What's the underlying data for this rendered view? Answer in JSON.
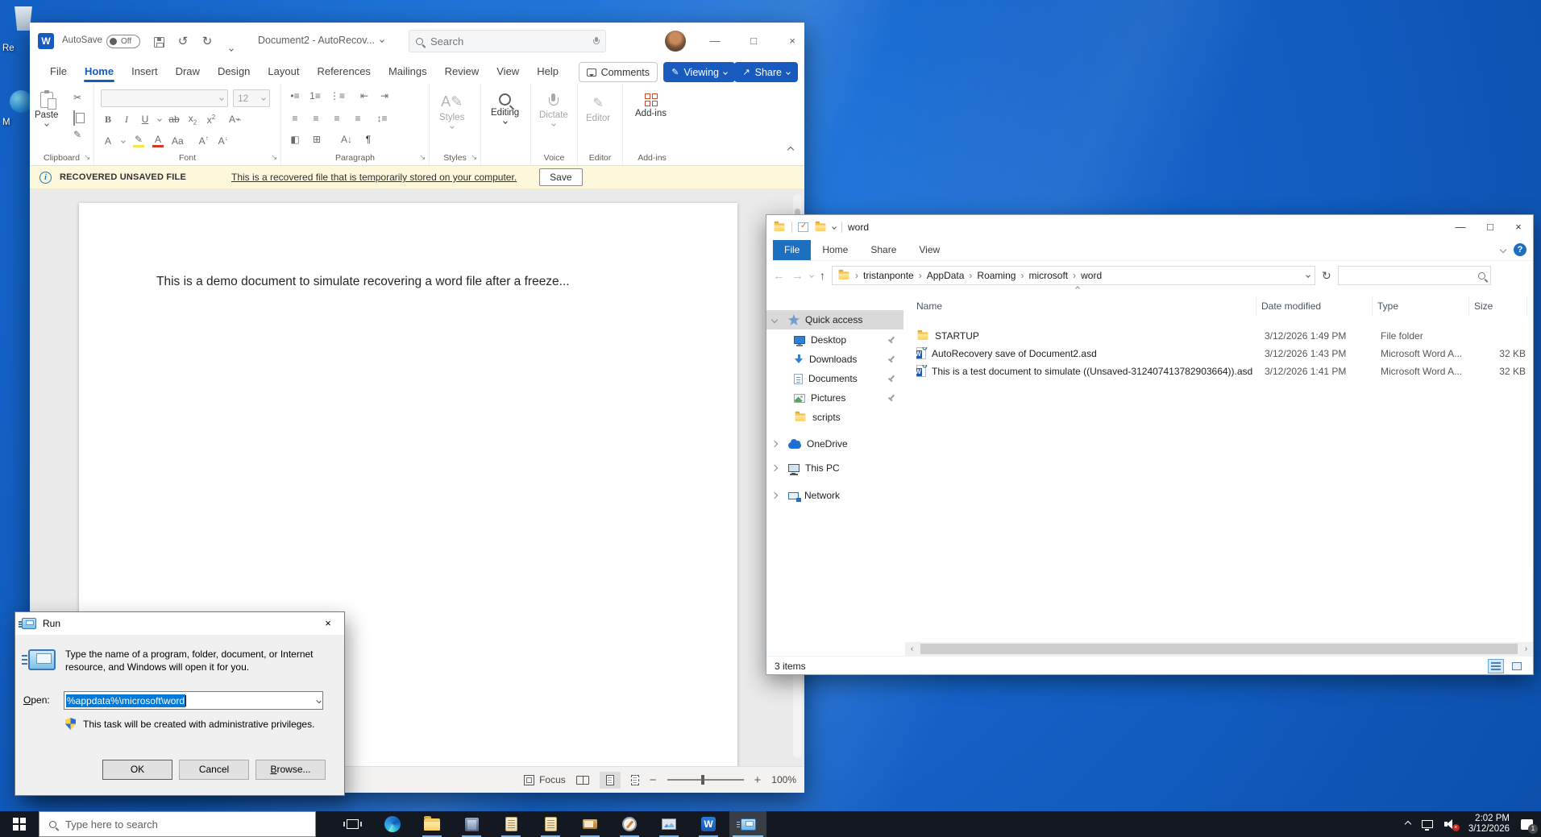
{
  "desktop": {
    "recycle_bin_label": "Re",
    "second_icon_label": "M"
  },
  "word": {
    "titlebar": {
      "autosave_label": "AutoSave",
      "autosave_state": "Off",
      "doc_title": "Document2 - AutoRecov...",
      "search_placeholder": "Search"
    },
    "tabs": [
      "File",
      "Home",
      "Insert",
      "Draw",
      "Design",
      "Layout",
      "References",
      "Mailings",
      "Review",
      "View",
      "Help"
    ],
    "buttons": {
      "comments": "Comments",
      "viewing": "Viewing",
      "share": "Share"
    },
    "ribbon": {
      "paste": "Paste",
      "font_size": "12",
      "styles": "Styles",
      "editing": "Editing",
      "dictate": "Dictate",
      "editor": "Editor",
      "addins": "Add-ins",
      "groups": {
        "clipboard": "Clipboard",
        "font": "Font",
        "paragraph": "Paragraph",
        "styles": "Styles",
        "voice": "Voice",
        "editor": "Editor",
        "addins": "Add-ins"
      }
    },
    "infobar": {
      "badge": "RECOVERED UNSAVED FILE",
      "message": "This is a recovered file that is temporarily stored on your computer.",
      "save": "Save"
    },
    "document_text": "This is a demo document to simulate recovering a word file after a freeze...",
    "statusbar": {
      "focus": "Focus",
      "zoom": "100%"
    }
  },
  "explorer": {
    "title": "word",
    "tabs": [
      "File",
      "Home",
      "Share",
      "View"
    ],
    "breadcrumb": [
      "tristanponte",
      "AppData",
      "Roaming",
      "microsoft",
      "word"
    ],
    "columns": [
      "Name",
      "Date modified",
      "Type",
      "Size"
    ],
    "files": [
      {
        "name": "STARTUP",
        "date": "3/12/2026 1:49 PM",
        "type": "File folder",
        "size": ""
      },
      {
        "name": "AutoRecovery save of Document2.asd",
        "date": "3/12/2026 1:43 PM",
        "type": "Microsoft Word A...",
        "size": "32 KB"
      },
      {
        "name": "This is a test document to simulate ((Unsaved-312407413782903664)).asd",
        "date": "3/12/2026 1:41 PM",
        "type": "Microsoft Word A...",
        "size": "32 KB"
      }
    ],
    "sidebar": {
      "quick_access": "Quick access",
      "desktop": "Desktop",
      "downloads": "Downloads",
      "documents": "Documents",
      "pictures": "Pictures",
      "scripts": "scripts",
      "onedrive": "OneDrive",
      "this_pc": "This PC",
      "network": "Network"
    },
    "status": "3 items"
  },
  "run": {
    "title": "Run",
    "description": "Type the name of a program, folder, document, or Internet resource, and Windows will open it for you.",
    "open_label": "Open:",
    "open_value": "%appdata%\\microsoft\\word",
    "admin_note": "This task will be created with administrative privileges.",
    "ok": "OK",
    "cancel": "Cancel",
    "browse": "Browse..."
  },
  "taskbar": {
    "search_placeholder": "Type here to search",
    "time": "2:02 PM",
    "date": "3/12/2026",
    "notification_count": "1"
  }
}
